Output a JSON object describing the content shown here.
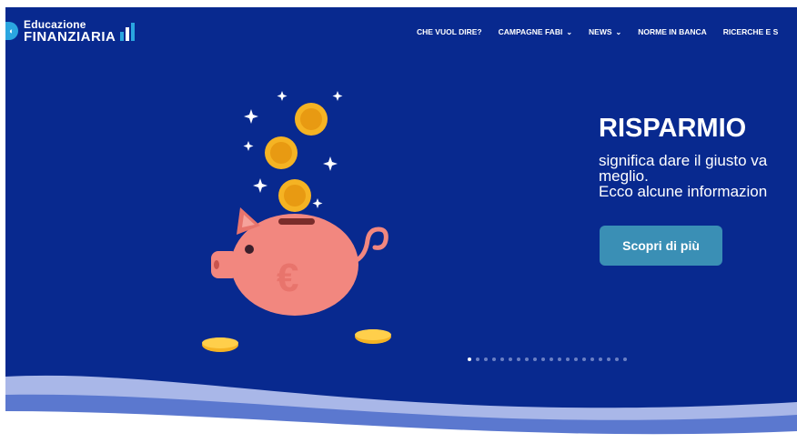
{
  "logo": {
    "line1": "Educazione",
    "line2": "FINANZIARIA"
  },
  "nav": {
    "items": [
      {
        "label": "CHE VUOL DIRE?",
        "has_dropdown": false
      },
      {
        "label": "CAMPAGNE FABI",
        "has_dropdown": true
      },
      {
        "label": "NEWS",
        "has_dropdown": true
      },
      {
        "label": "NORME IN BANCA",
        "has_dropdown": false
      },
      {
        "label": "RICERCHE E S",
        "has_dropdown": false
      }
    ],
    "dropdown_icon": "chevron-down-icon"
  },
  "hero": {
    "headline": "RISPARMIO",
    "line1": "significa dare il giusto va",
    "line2": "meglio.",
    "line3": "Ecco alcune informazion",
    "cta_label": "Scopri di più",
    "illustration": "piggy-bank-with-euro-coins",
    "slider": {
      "total_slides": 20,
      "active_index": 1
    }
  },
  "colors": {
    "hero_background": "#08298f",
    "cta_background": "#3a8fb5",
    "pig": "#f2877f",
    "coin": "#f5b323",
    "wave_light": "#a9b7e8",
    "wave_mid": "#5b78cf"
  }
}
